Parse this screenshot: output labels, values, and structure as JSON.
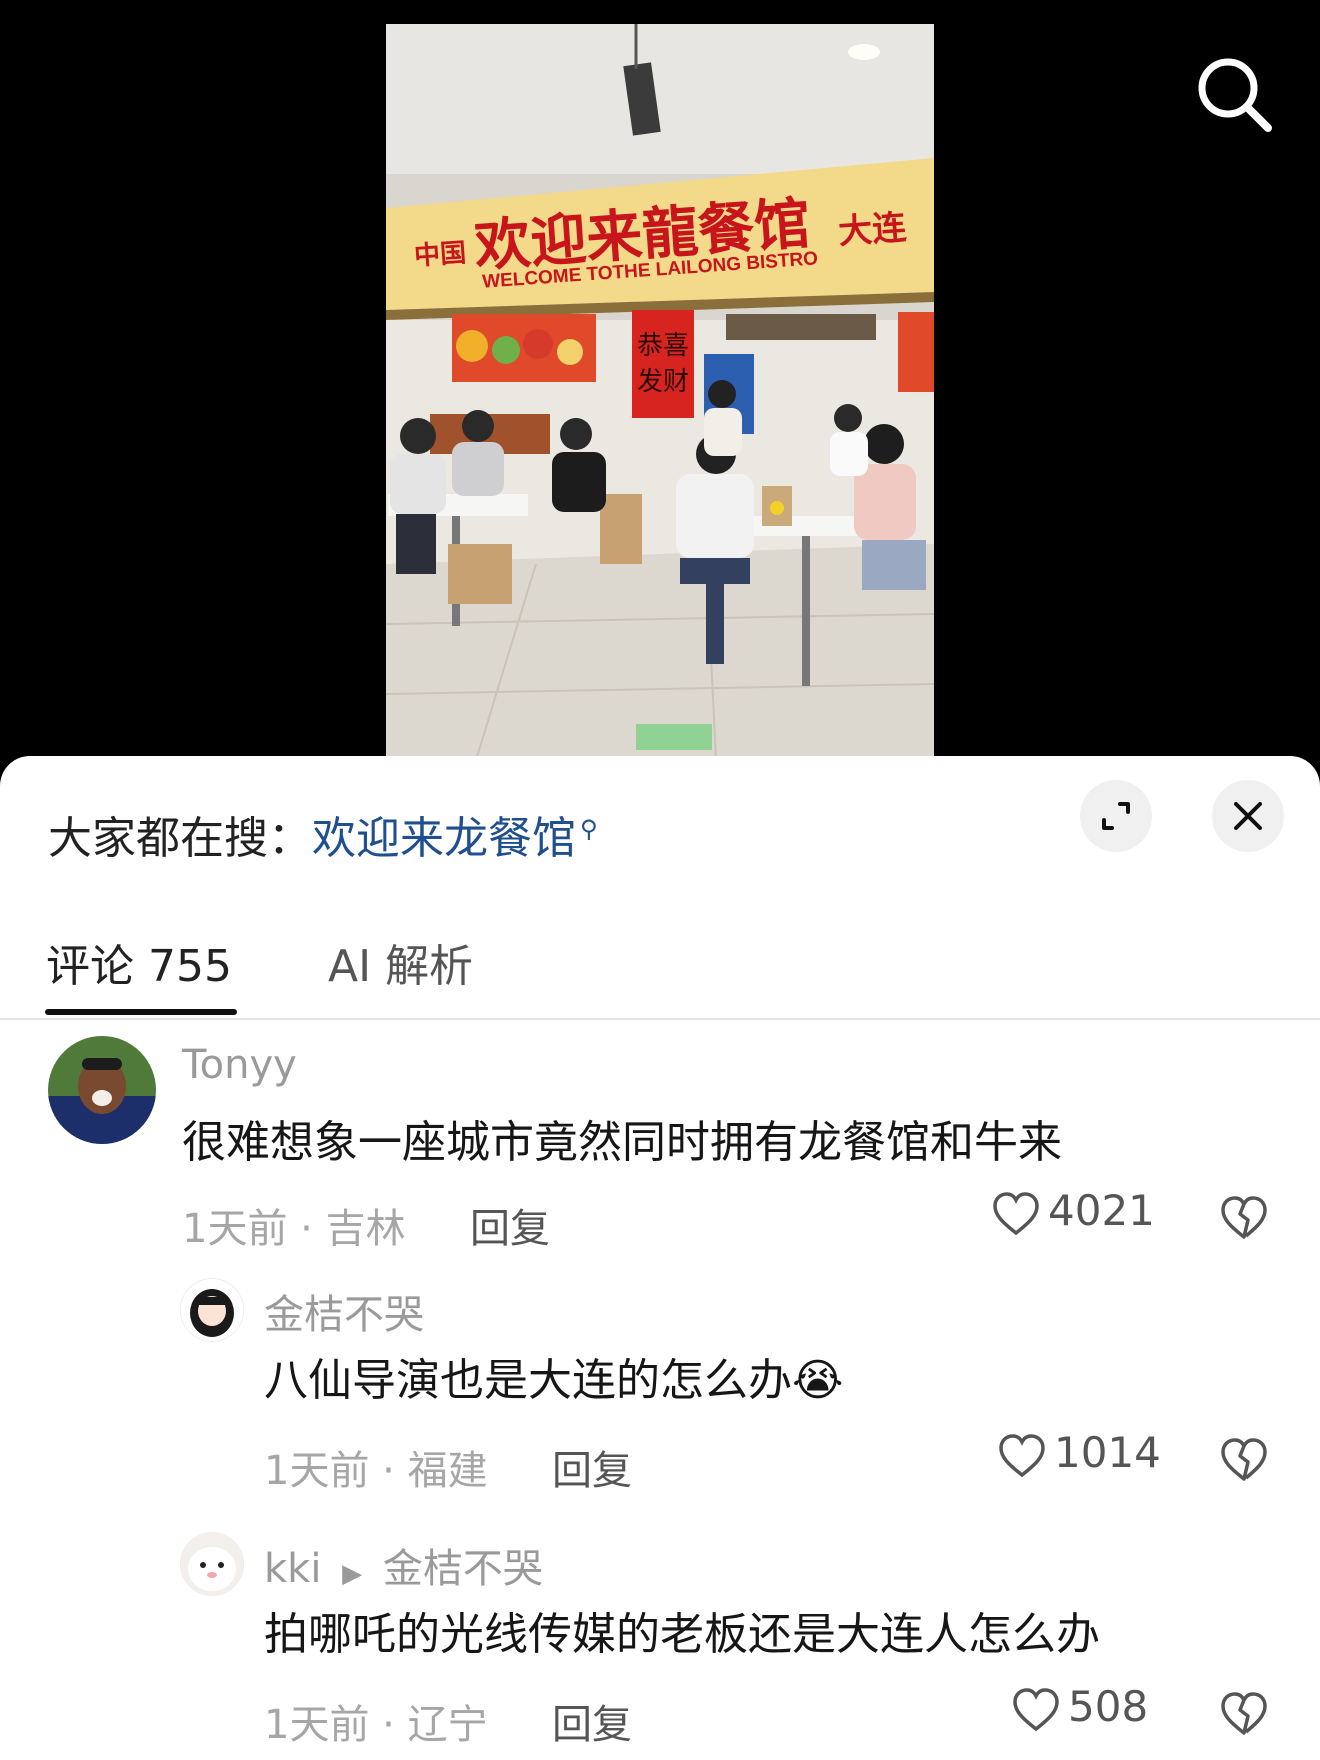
{
  "photo": {
    "sign_cn_prefix": "中国",
    "sign_title": "欢迎来龍餐馆",
    "sign_cn_suffix": "大连",
    "sign_en": "WELCOME TOTHE LAILONG BISTRO",
    "banner_text": "恭喜发财"
  },
  "search_bar": {
    "label": "大家都在搜：",
    "term": "欢迎来龙餐馆"
  },
  "tabs": [
    {
      "label": "评论 755",
      "active": true
    },
    {
      "label": "AI 解析",
      "active": false
    }
  ],
  "comments": [
    {
      "username": "Tonyy",
      "text": "很难想象一座城市竟然同时拥有龙餐馆和牛来",
      "meta": "1天前 · 吉林",
      "reply_label": "回复",
      "likes": "4021"
    },
    {
      "username": "金桔不哭",
      "text": "八仙导演也是大连的怎么办",
      "emoji": "😭",
      "meta": "1天前 · 福建",
      "reply_label": "回复",
      "likes": "1014"
    },
    {
      "username": "kki",
      "reply_to": "金桔不哭",
      "text": "拍哪吒的光线传媒的老板还是大连人怎么办",
      "meta": "1天前 · 辽宁",
      "reply_label": "回复",
      "likes": "508"
    }
  ],
  "colors": {
    "accent": "#1f4f8f",
    "sign_bg": "#f3d98a",
    "sign_text": "#c8141b"
  }
}
